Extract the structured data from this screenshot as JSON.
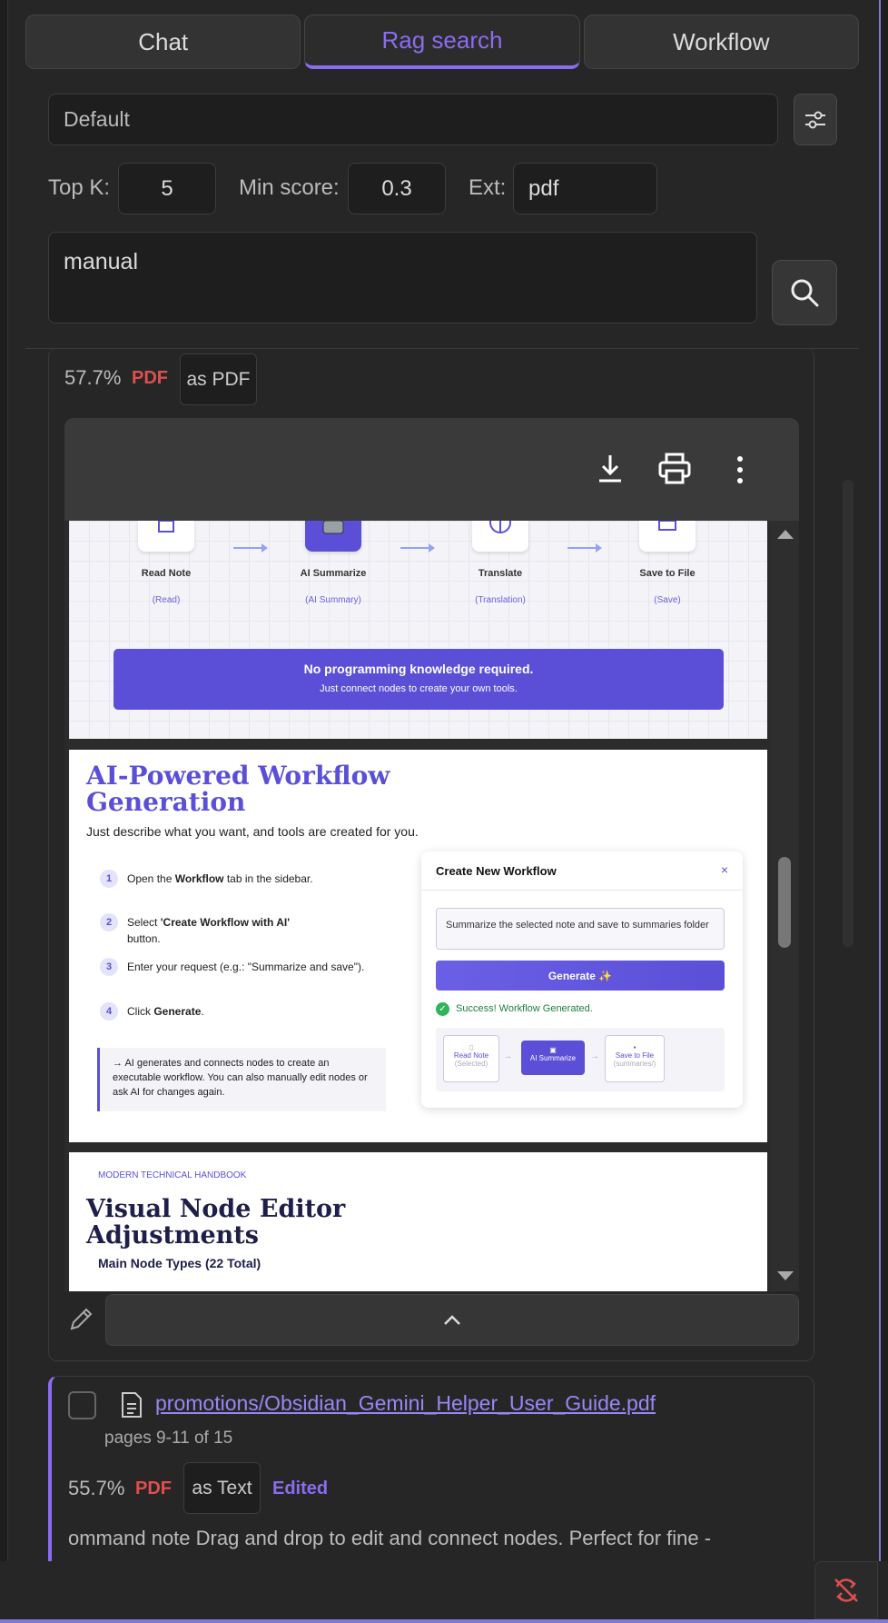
{
  "tabs": [
    {
      "label": "Chat",
      "active": false
    },
    {
      "label": "Rag search",
      "active": true
    },
    {
      "label": "Workflow",
      "active": false
    }
  ],
  "store_select": {
    "value": "Default"
  },
  "filters": {
    "topk_label": "Top K:",
    "topk_value": "5",
    "minscore_label": "Min score:",
    "minscore_value": "0.3",
    "ext_label": "Ext:",
    "ext_value": "pdf"
  },
  "query": {
    "value": "manual"
  },
  "result1": {
    "score": "57.7%",
    "type": "PDF",
    "view_mode": "as PDF",
    "viewer": {
      "flow_nodes": [
        {
          "title": "Read Note",
          "sub": "(Read)"
        },
        {
          "title": "AI Summarize",
          "sub": "(AI Summary)"
        },
        {
          "title": "Translate",
          "sub": "(Translation)"
        },
        {
          "title": "Save to File",
          "sub": "(Save)"
        }
      ],
      "banner_title": "No programming knowledge required.",
      "banner_sub": "Just connect nodes to create your own tools.",
      "page2_title_line1": "AI-Powered Workflow",
      "page2_title_line2": "Generation",
      "page2_subtitle": "Just describe what you want, and tools are created for you.",
      "steps": [
        {
          "num": "1",
          "text_a": "Open the ",
          "bold": "Workflow",
          "text_b": " tab in the sidebar."
        },
        {
          "num": "2",
          "text_a": "Select ",
          "bold": "'Create Workflow with AI'",
          "text_b": ""
        },
        {
          "num": "3",
          "text_a": "Enter your request (e.g.: \"Summarize and save\").",
          "bold": "",
          "text_b": ""
        },
        {
          "num": "4",
          "text_a": "Click ",
          "bold": "Generate",
          "text_b": "."
        }
      ],
      "step2_cont": "button.",
      "note": "→ AI generates and connects nodes to create an executable workflow. You can also manually edit nodes or ask AI for changes again.",
      "dialog": {
        "title": "Create New Workflow",
        "close": "×",
        "input": "Summarize the selected note and save to summaries folder",
        "button": "Generate ✨",
        "success": "Success! Workflow Generated.",
        "mini_nodes": [
          {
            "title": "Read Note",
            "sub": "(Selected)"
          },
          {
            "title": "AI Summarize",
            "sub": ""
          },
          {
            "title": "Save to File",
            "sub": "(summaries/)"
          }
        ]
      },
      "page3_kicker": "MODERN TECHNICAL HANDBOOK",
      "page3_title_line1": "Visual Node Editor",
      "page3_title_line2": "Adjustments",
      "page3_sub": "Main Node Types (22 Total)"
    }
  },
  "result2": {
    "path": "promotions/Obsidian_Gemini_Helper_User_Guide.pdf",
    "pages": "pages 9-11 of 15",
    "score": "55.7%",
    "type": "PDF",
    "view_mode": "as Text",
    "edited": "Edited",
    "snippet": "ommand   note  Drag and drop to edit and connect nodes. Perfect for fine -"
  },
  "colors": {
    "accent": "#8b6cf0",
    "pdf": "#e04f4f",
    "banner": "#5b4fd8"
  }
}
